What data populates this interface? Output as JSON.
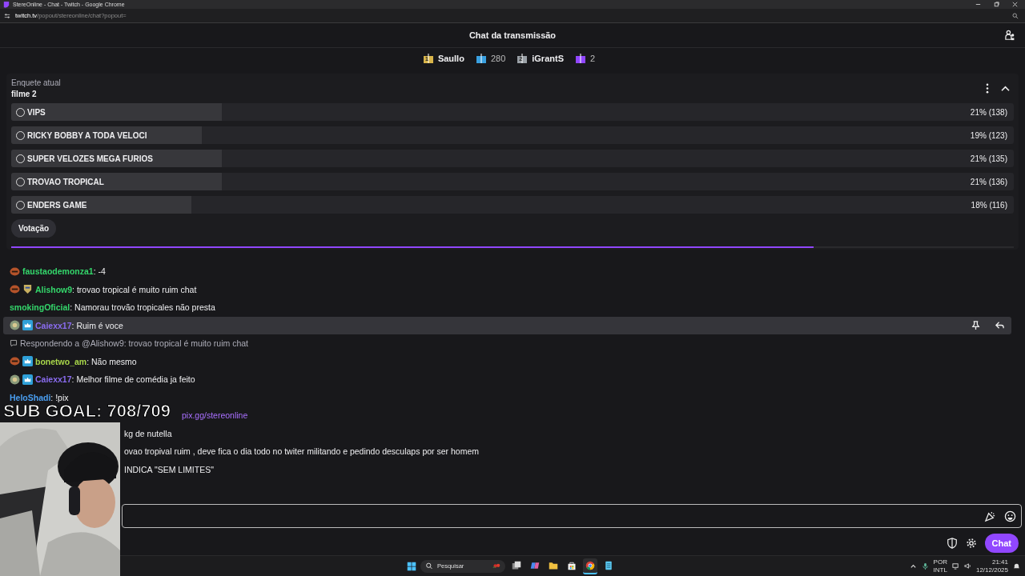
{
  "browser": {
    "title": "StereOnline - Chat - Twitch - Google Chrome",
    "url_host": "twitch.tv",
    "url_path": "/popout/stereonline/chat?popout="
  },
  "header": {
    "title": "Chat da transmissão"
  },
  "gift_leaders": [
    {
      "kind": "name",
      "rank": "1",
      "color": "#d9b54a",
      "text": "Saullo"
    },
    {
      "kind": "count",
      "color": "#3aa0e0",
      "text": "280"
    },
    {
      "kind": "name",
      "rank": "2",
      "color": "#9aa0a6",
      "text": "iGrantS"
    },
    {
      "kind": "count",
      "color": "#9146ff",
      "text": "2"
    }
  ],
  "poll": {
    "label": "Enquete atual",
    "title": "filme 2",
    "options": [
      {
        "text": "VIPS",
        "result": "21% (138)",
        "level": 0.21,
        "selected": false
      },
      {
        "text": "RICKY BOBBY A TODA VELOCI",
        "result": "19% (123)",
        "level": 0.19,
        "selected": false
      },
      {
        "text": "SUPER VELOZES MEGA FURIOS",
        "result": "21% (135)",
        "level": 0.21,
        "selected": false
      },
      {
        "text": "TROVAO TROPICAL",
        "result": "21% (136)",
        "level": 0.21,
        "selected": false
      },
      {
        "text": "ENDERS GAME",
        "result": "18% (116)",
        "level": 0.18,
        "selected": false
      }
    ],
    "vote_button": "Votação",
    "timer": {
      "level": 0.8
    }
  },
  "chat": [
    {
      "kind": "message",
      "badges": [
        {
          "kind": "emote"
        }
      ],
      "user": "faustaodemonza1",
      "color": "#34d66b",
      "text": ": -4",
      "highlighted": false
    },
    {
      "kind": "message",
      "badges": [
        {
          "kind": "emote"
        },
        {
          "kind": "shield"
        }
      ],
      "user": "Alishow9",
      "color": "#34d66b",
      "text": ": trovao tropical é muito ruim chat",
      "highlighted": false
    },
    {
      "kind": "message",
      "user": "smokingOficial",
      "color": "#34d66b",
      "text": ": Namorau trovão tropicales não presta",
      "highlighted": false
    },
    {
      "kind": "message",
      "badges": [
        {
          "kind": "avatar"
        },
        {
          "kind": "crown"
        }
      ],
      "user": "Caiexx17",
      "color": "#8a6cf0",
      "text": ": Ruim é voce",
      "highlighted": true
    },
    {
      "kind": "reply",
      "text": "Respondendo a @Alishow9: trovao tropical é muito ruim chat",
      "highlighted": false
    },
    {
      "kind": "message",
      "badges": [
        {
          "kind": "emote"
        },
        {
          "kind": "crown"
        }
      ],
      "user": "bonetwo_am",
      "color": "#a8d64a",
      "text": ": Não mesmo",
      "highlighted": false
    },
    {
      "kind": "message",
      "badges": [
        {
          "kind": "avatar"
        },
        {
          "kind": "crown"
        }
      ],
      "user": "Caiexx17",
      "color": "#8a6cf0",
      "text": ": Melhor filme de comédia ja feito",
      "highlighted": false
    },
    {
      "kind": "message",
      "user": "HeloShadi",
      "color": "#4a9ef0",
      "text": ": !pix",
      "highlighted": false
    },
    {
      "kind": "link",
      "text": "pix.gg/stereonline",
      "highlighted": false
    },
    {
      "kind": "partial",
      "text": "kg de nutella",
      "highlighted": false
    },
    {
      "kind": "partial",
      "text": "ovao tropival ruim , deve fica o dia todo no twiter militando e pedindo desculaps por ser homem",
      "highlighted": false
    },
    {
      "kind": "partial",
      "text": "INDICA \"SEM LIMITES\"",
      "highlighted": false
    }
  ],
  "chat_button": "Chat",
  "overlay": {
    "text": "SUB GOAL: 708/709"
  },
  "taskbar": {
    "search": "Pesquisar",
    "apps": [
      {
        "kind": "taskview",
        "active": false
      },
      {
        "kind": "copilot",
        "active": false
      },
      {
        "kind": "folder",
        "active": false
      },
      {
        "kind": "store",
        "active": false
      },
      {
        "kind": "chrome",
        "active": true
      },
      {
        "kind": "notepad",
        "active": false
      }
    ],
    "lang": "POR",
    "layout": "INTL",
    "time": "21:41",
    "date": "12/12/2025"
  }
}
